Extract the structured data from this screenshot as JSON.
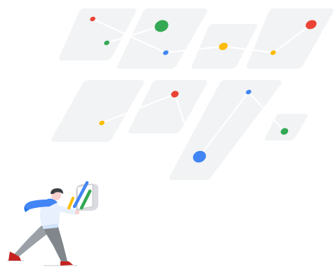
{
  "illustration": {
    "palette": {
      "tile": "#f1f3f4",
      "connector": "#ffffff",
      "google_red": "#ea4335",
      "google_green": "#34a853",
      "google_blue": "#4285f4",
      "google_yellow": "#fbbc04"
    },
    "nodes": [
      {
        "name": "node-red-small-1",
        "color": "google_red"
      },
      {
        "name": "node-green-small-1",
        "color": "google_green"
      },
      {
        "name": "node-green-large",
        "color": "google_green"
      },
      {
        "name": "node-blue-small-1",
        "color": "google_blue"
      },
      {
        "name": "node-yellow-1",
        "color": "google_yellow"
      },
      {
        "name": "node-yellow-2",
        "color": "google_yellow"
      },
      {
        "name": "node-red-large",
        "color": "google_red"
      },
      {
        "name": "node-yellow-3",
        "color": "google_yellow"
      },
      {
        "name": "node-red-2",
        "color": "google_red"
      },
      {
        "name": "node-blue-small-2",
        "color": "google_blue"
      },
      {
        "name": "node-blue-large",
        "color": "google_blue"
      },
      {
        "name": "node-green-2",
        "color": "google_green"
      }
    ],
    "person": {
      "description_icon": "person-carrying-chart-icon",
      "scarf_color": "#4285f4",
      "shirt_color": "#e8f0fe",
      "pants_color": "#9aa0a6",
      "shoe_color": "#c5221f",
      "hair_color": "#3c4043",
      "skin_color": "#fad2cf"
    },
    "chart_board": {
      "bar_colors": [
        "google_yellow",
        "google_green",
        "google_blue"
      ]
    }
  }
}
